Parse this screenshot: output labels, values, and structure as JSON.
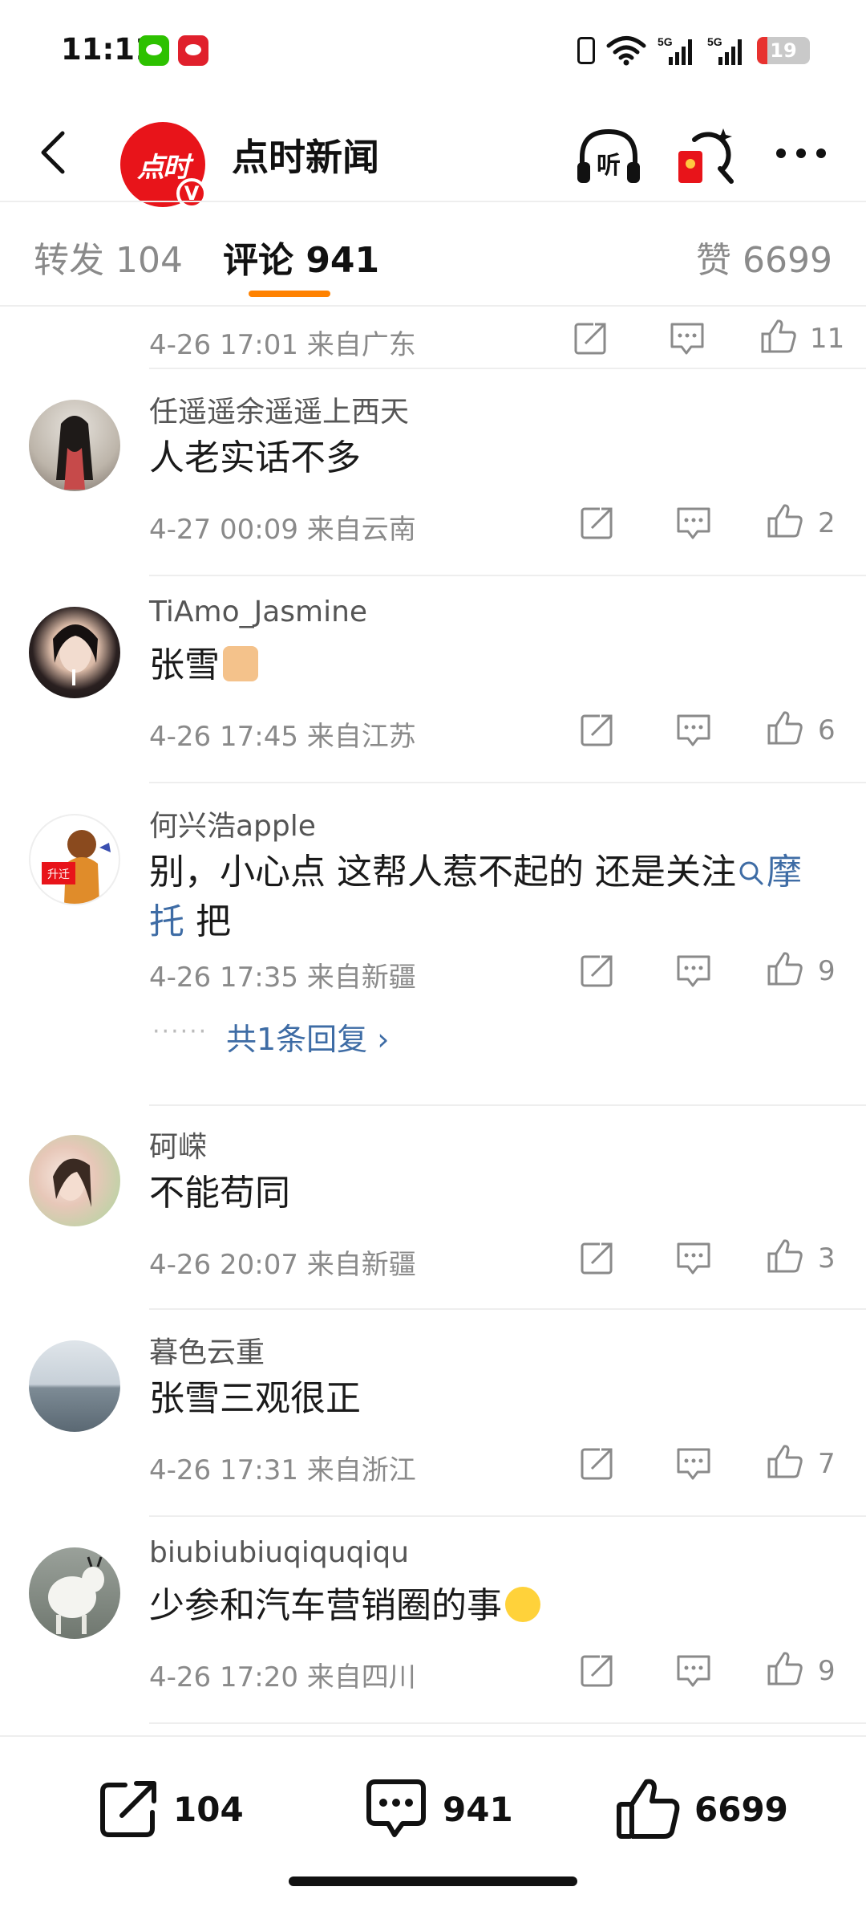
{
  "status_bar": {
    "time": "11:11",
    "network": "5G",
    "battery_percent": 19,
    "battery_label": "19",
    "battery_color": "#e8322f"
  },
  "header": {
    "account_name": "点时新闻",
    "logo_text": "点时",
    "verified_badge": "V",
    "listen_label": "听",
    "brand_color": "#e8141a"
  },
  "tabs": {
    "repost": "转发 104",
    "comment": "评论 941",
    "like": "赞 6699",
    "active_color": "#ff8200"
  },
  "comments": [
    {
      "username": "",
      "text": "",
      "time": "4-26 17:01",
      "location": "来自广东",
      "likes": "11"
    },
    {
      "username": "任遥遥余遥遥上西天",
      "text": "人老实话不多",
      "time": "4-27 00:09",
      "location": "来自云南",
      "likes": "2"
    },
    {
      "username": "TiAmo_Jasmine",
      "text": "张雪",
      "emoji": "thumbs-up-emoji",
      "time": "4-26 17:45",
      "location": "来自江苏",
      "likes": "6"
    },
    {
      "username": "何兴浩apple",
      "text_before": "别，小心点 这帮人惹不起的 还是关注",
      "topic_link": "摩托",
      "text_after": " 把",
      "avatar_badge": "升迁",
      "time": "4-26 17:35",
      "location": "来自新疆",
      "likes": "9",
      "reply_dots": "······",
      "replies_label": "共1条回复 ›"
    },
    {
      "username": "砢嵘",
      "text": "不能苟同",
      "time": "4-26 20:07",
      "location": "来自新疆",
      "likes": "3"
    },
    {
      "username": "暮色云重",
      "text": "张雪三观很正",
      "time": "4-26 17:31",
      "location": "来自浙江",
      "likes": "7"
    },
    {
      "username": "biubiubiuqiquqiqu",
      "text": "少参和汽车营销圈的事",
      "emoji": "laughing-crying-emoji",
      "time": "4-26 17:20",
      "location": "来自四川",
      "likes": "9"
    }
  ],
  "bottom_bar": {
    "repost_count": "104",
    "comment_count": "941",
    "like_count": "6699"
  },
  "colors": {
    "link": "#3e6ca5",
    "meta_text": "#8a8a8a",
    "divider": "#eeeeee"
  }
}
